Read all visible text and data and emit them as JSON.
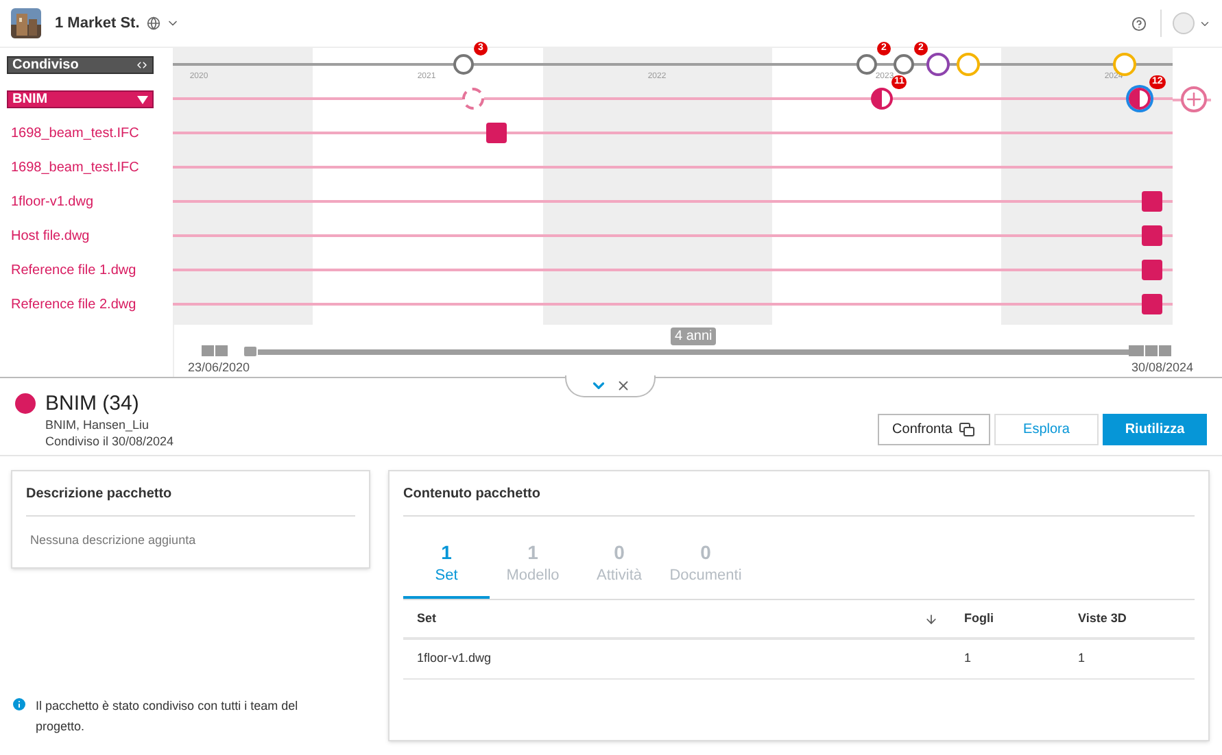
{
  "header": {
    "project": "1 Market St."
  },
  "timeline": {
    "shared_row": {
      "label": "Condiviso",
      "markers": [
        {
          "kind": "share",
          "badge": "3"
        },
        {
          "kind": "share",
          "badge": "2"
        },
        {
          "kind": "share",
          "badge": "2"
        },
        {
          "kind": "ring",
          "color": "#8e44ad"
        },
        {
          "kind": "ring",
          "color": "#f5b400"
        },
        {
          "kind": "ring",
          "color": "#f5b400"
        }
      ]
    },
    "years": [
      "2020",
      "2021",
      "2022",
      "2023",
      "2024"
    ],
    "team_row": {
      "label": "BNIM",
      "markers": [
        {
          "kind": "pending"
        },
        {
          "kind": "package",
          "badge": "11",
          "selected": false
        },
        {
          "kind": "package",
          "badge": "12",
          "selected": true
        }
      ]
    },
    "files": [
      {
        "name": "1698_beam_test.IFC",
        "markers": [
          {
            "kind": "version"
          }
        ]
      },
      {
        "name": "1698_beam_test.IFC"
      },
      {
        "name": "1floor-v1.dwg",
        "markers": [
          {
            "kind": "version"
          }
        ]
      },
      {
        "name": "Host file.dwg",
        "markers": [
          {
            "kind": "version"
          }
        ]
      },
      {
        "name": "Reference file 1.dwg",
        "markers": [
          {
            "kind": "version"
          }
        ]
      },
      {
        "name": "Reference file 2.dwg",
        "markers": [
          {
            "kind": "version"
          }
        ]
      }
    ],
    "range_label": "4 anni",
    "start_date": "23/06/2020",
    "end_date": "30/08/2024"
  },
  "package": {
    "title": "BNIM (34)",
    "color": "#d81b60",
    "members": "BNIM, Hansen_Liu",
    "shared": "Condiviso il 30/08/2024",
    "buttons": [
      {
        "label": "Confronta",
        "kind": "compare"
      },
      {
        "label": "Esplora",
        "kind": "secondary"
      },
      {
        "label": "Riutilizza",
        "kind": "primary"
      }
    ]
  },
  "description": {
    "title": "Descrizione pacchetto",
    "text": "Nessuna descrizione aggiunta"
  },
  "note": "Il pacchetto è stato condiviso con tutti i team del progetto.",
  "content": {
    "title": "Contenuto pacchetto",
    "tabs": [
      {
        "count": "1",
        "label": "Set",
        "selected": true
      },
      {
        "count": "1",
        "label": "Modello",
        "selected": false
      },
      {
        "count": "0",
        "label": "Attività",
        "selected": false
      },
      {
        "count": "0",
        "label": "Documenti",
        "selected": false
      }
    ],
    "columns": [
      "Set",
      "Fogli",
      "Viste 3D"
    ],
    "rows": [
      [
        "1floor-v1.dwg",
        "1",
        "1"
      ]
    ]
  }
}
